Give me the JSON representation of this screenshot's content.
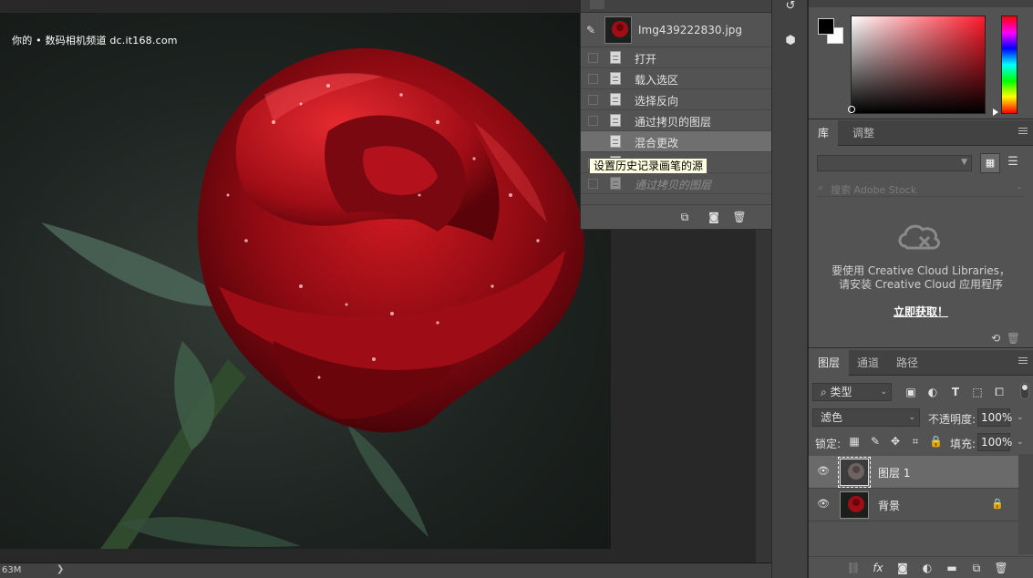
{
  "canvas": {
    "watermark": "你的 • 数码相机频道  dc.it168.com",
    "status_size": "63M",
    "status_arrow": "❯"
  },
  "history": {
    "snapshot_name": "Img439222830.jpg",
    "items": [
      {
        "label": "打开",
        "state": "normal"
      },
      {
        "label": "载入选区",
        "state": "normal"
      },
      {
        "label": "选择反向",
        "state": "normal"
      },
      {
        "label": "通过拷贝的图层",
        "state": "normal"
      },
      {
        "label": "混合更改",
        "state": "active"
      },
      {
        "label": "",
        "state": "hidden"
      },
      {
        "label": "通过拷贝的图层",
        "state": "faded"
      }
    ],
    "tooltip": "设置历史记录画笔的源"
  },
  "library": {
    "tabs": [
      "库",
      "调整"
    ],
    "search_placeholder": "搜索 Adobe Stock",
    "message_line1": "要使用 Creative Cloud Libraries，",
    "message_line2": "请安装 Creative Cloud 应用程序",
    "install_link": "立即获取！"
  },
  "layers": {
    "tabs": [
      "图层",
      "通道",
      "路径"
    ],
    "filter_kind": "类型",
    "blend_mode": "滤色",
    "opacity_label": "不透明度:",
    "opacity_value": "100%",
    "lock_label": "锁定:",
    "fill_label": "填充:",
    "fill_value": "100%",
    "items": [
      {
        "name": "图层 1",
        "selected": true,
        "locked": false
      },
      {
        "name": "背景",
        "selected": false,
        "locked": true
      }
    ]
  },
  "colors": {
    "foreground": "#000000",
    "background": "#ffffff",
    "hue_base": "#ff1a2a"
  }
}
